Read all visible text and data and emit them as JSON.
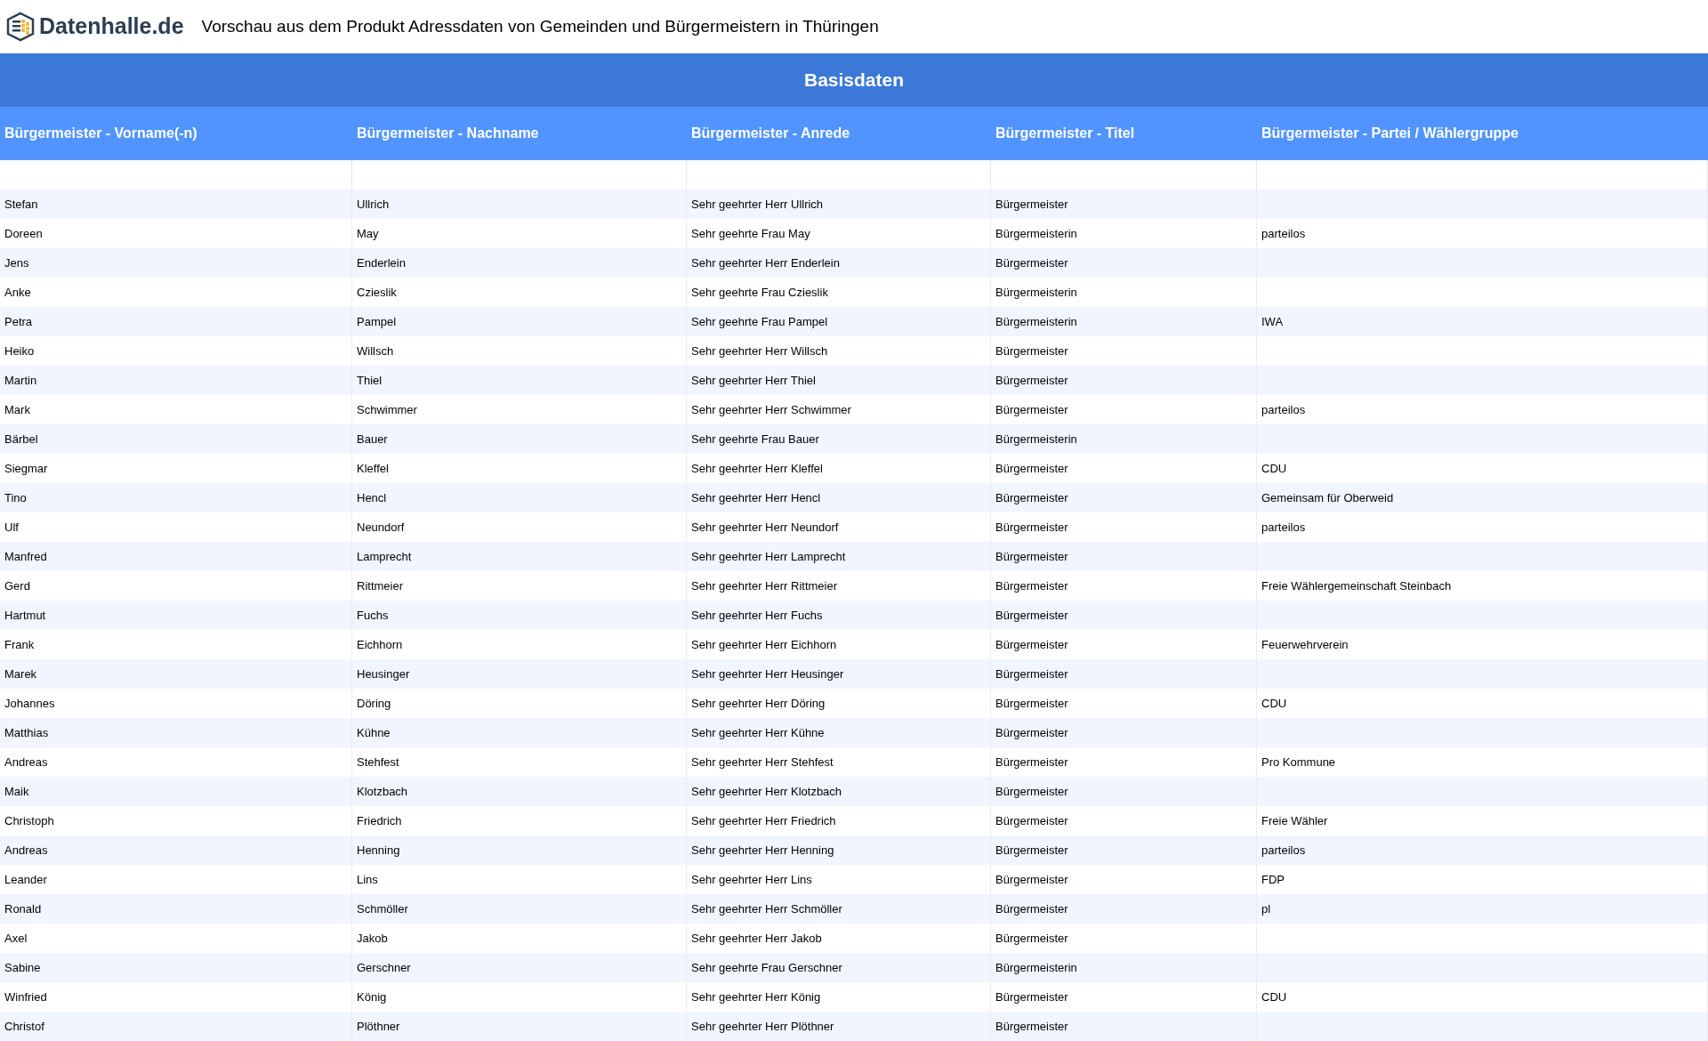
{
  "header": {
    "logo": "Datenhalle.de",
    "title": "Vorschau aus dem Produkt Adressdaten von Gemeinden und Bürgermeistern in Thüringen"
  },
  "table": {
    "group_title": "Basisdaten",
    "columns": [
      "Bürgermeister - Vorname(-n)",
      "Bürgermeister - Nachname",
      "Bürgermeister - Anrede",
      "Bürgermeister - Titel",
      "Bürgermeister - Partei / Wählergruppe"
    ],
    "rows": [
      {
        "first": "Stefan",
        "last": "Ullrich",
        "salutation": "Sehr geehrter Herr Ullrich",
        "title": "Bürgermeister"
      },
      {
        "first": "Doreen",
        "last": "May",
        "salutation": "Sehr geehrte Frau May",
        "title": "Bürgermeisterin",
        "party": "parteilos"
      },
      {
        "first": "Jens",
        "last": "Enderlein",
        "salutation": "Sehr geehrter Herr Enderlein",
        "title": "Bürgermeister"
      },
      {
        "first": "Anke",
        "last": "Czieslik",
        "salutation": "Sehr geehrte Frau Czieslik",
        "title": "Bürgermeisterin"
      },
      {
        "first": "Petra",
        "last": "Pampel",
        "salutation": "Sehr geehrte Frau Pampel",
        "title": "Bürgermeisterin",
        "party": "IWA"
      },
      {
        "first": "Heiko",
        "last": "Willsch",
        "salutation": "Sehr geehrter Herr Willsch",
        "title": "Bürgermeister"
      },
      {
        "first": "Martin",
        "last": "Thiel",
        "salutation": "Sehr geehrter Herr Thiel",
        "title": "Bürgermeister"
      },
      {
        "first": "Mark",
        "last": "Schwimmer",
        "salutation": "Sehr geehrter Herr Schwimmer",
        "title": "Bürgermeister",
        "party": "parteilos"
      },
      {
        "first": "Bärbel",
        "last": "Bauer",
        "salutation": "Sehr geehrte Frau Bauer",
        "title": "Bürgermeisterin"
      },
      {
        "first": "Siegmar",
        "last": "Kleffel",
        "salutation": "Sehr geehrter Herr Kleffel",
        "title": "Bürgermeister",
        "party": "CDU"
      },
      {
        "first": "Tino",
        "last": "Hencl",
        "salutation": "Sehr geehrter Herr Hencl",
        "title": "Bürgermeister",
        "party": "Gemeinsam für Oberweid"
      },
      {
        "first": "Ulf",
        "last": "Neundorf",
        "salutation": "Sehr geehrter Herr Neundorf",
        "title": "Bürgermeister",
        "party": "parteilos"
      },
      {
        "first": "Manfred",
        "last": "Lamprecht",
        "salutation": "Sehr geehrter Herr Lamprecht",
        "title": "Bürgermeister"
      },
      {
        "first": "Gerd",
        "last": "Rittmeier",
        "salutation": "Sehr geehrter Herr Rittmeier",
        "title": "Bürgermeister",
        "party": "Freie Wählergemeinschaft Steinbach"
      },
      {
        "first": "Hartmut",
        "last": "Fuchs",
        "salutation": "Sehr geehrter Herr Fuchs",
        "title": "Bürgermeister"
      },
      {
        "first": "Frank",
        "last": "Eichhorn",
        "salutation": "Sehr geehrter Herr Eichhorn",
        "title": "Bürgermeister",
        "party": "Feuerwehrverein"
      },
      {
        "first": "Marek",
        "last": "Heusinger",
        "salutation": "Sehr geehrter Herr Heusinger",
        "title": "Bürgermeister"
      },
      {
        "first": "Johannes",
        "last": "Döring",
        "salutation": "Sehr geehrter Herr Döring",
        "title": "Bürgermeister",
        "party": "CDU"
      },
      {
        "first": "Matthias",
        "last": "Kühne",
        "salutation": "Sehr geehrter Herr Kühne",
        "title": "Bürgermeister"
      },
      {
        "first": "Andreas",
        "last": "Stehfest",
        "salutation": "Sehr geehrter Herr Stehfest",
        "title": "Bürgermeister",
        "party": "Pro Kommune"
      },
      {
        "first": "Maik",
        "last": "Klotzbach",
        "salutation": "Sehr geehrter Herr Klotzbach",
        "title": "Bürgermeister"
      },
      {
        "first": "Christoph",
        "last": "Friedrich",
        "salutation": "Sehr geehrter Herr Friedrich",
        "title": "Bürgermeister",
        "party": "Freie Wähler"
      },
      {
        "first": "Andreas",
        "last": "Henning",
        "salutation": "Sehr geehrter Herr Henning",
        "title": "Bürgermeister",
        "party": "parteilos"
      },
      {
        "first": "Leander",
        "last": "Lins",
        "salutation": "Sehr geehrter Herr Lins",
        "title": "Bürgermeister",
        "party": "FDP"
      },
      {
        "first": "Ronald",
        "last": "Schmöller",
        "salutation": "Sehr geehrter Herr Schmöller",
        "title": "Bürgermeister",
        "party": "pl"
      },
      {
        "first": "Axel",
        "last": "Jakob",
        "salutation": "Sehr geehrter Herr Jakob",
        "title": "Bürgermeister"
      },
      {
        "first": "Sabine",
        "last": "Gerschner",
        "salutation": "Sehr geehrte Frau Gerschner",
        "title": "Bürgermeisterin"
      },
      {
        "first": "Winfried",
        "last": "König",
        "salutation": "Sehr geehrter Herr König",
        "title": "Bürgermeister",
        "party": "CDU"
      },
      {
        "first": "Christof",
        "last": "Plöthner",
        "salutation": "Sehr geehrter Herr Plöthner",
        "title": "Bürgermeister"
      }
    ]
  }
}
